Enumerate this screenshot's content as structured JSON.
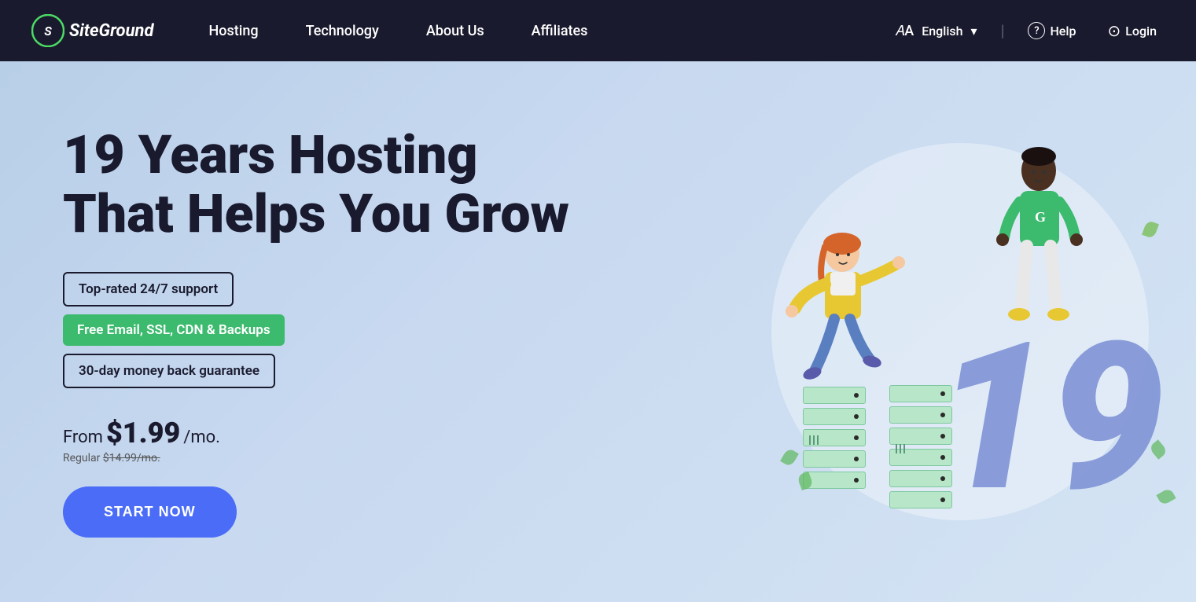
{
  "nav": {
    "logo_text": "SiteGround",
    "links": [
      {
        "label": "Hosting",
        "id": "hosting"
      },
      {
        "label": "Technology",
        "id": "technology"
      },
      {
        "label": "About Us",
        "id": "about-us"
      },
      {
        "label": "Affiliates",
        "id": "affiliates"
      }
    ],
    "language": "English",
    "help": "Help",
    "login": "Login"
  },
  "hero": {
    "title_line1": "19 Years Hosting",
    "title_line2": "That Helps You Grow",
    "badge1": "Top-rated 24/7 support",
    "badge2": "Free Email, SSL, CDN & Backups",
    "badge3": "30-day money back guarantee",
    "pricing_from": "From",
    "pricing_price": "$1.99",
    "pricing_period": "/mo.",
    "pricing_regular_label": "Regular",
    "pricing_regular_price": "$14.99/mo.",
    "cta_button": "START NOW",
    "big_number": "19"
  },
  "icons": {
    "translate": "𝐴",
    "chevron_down": "▾",
    "help_circle": "?",
    "user_circle": "⊙",
    "logo_symbol": "⊛"
  }
}
